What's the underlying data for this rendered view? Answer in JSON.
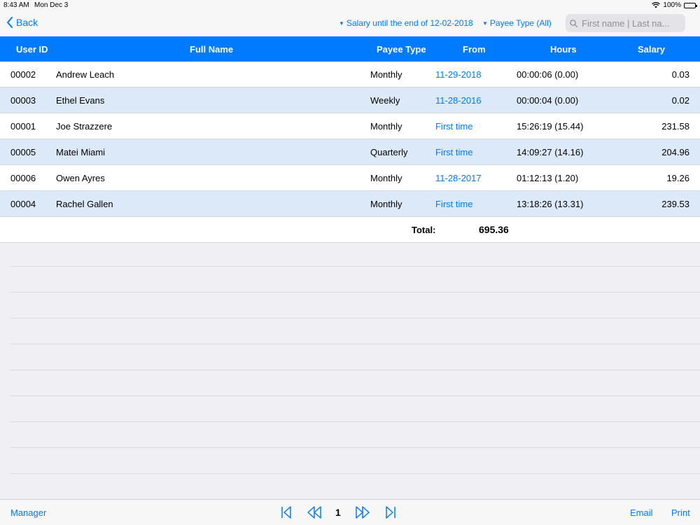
{
  "status_bar": {
    "time": "8:43 AM",
    "date": "Mon Dec 3",
    "battery": "100%"
  },
  "navbar": {
    "back_label": "Back",
    "salary_filter": "Salary until the end of 12-02-2018",
    "payee_filter": "Payee Type (All)",
    "search_placeholder": "First name | Last na..."
  },
  "table": {
    "columns": [
      "User ID",
      "Full Name",
      "Payee Type",
      "From",
      "Hours",
      "Salary"
    ],
    "rows": [
      {
        "user_id": "00002",
        "full_name": "Andrew Leach",
        "payee_type": "Monthly",
        "from": "11-29-2018",
        "hours": "00:00:06 (0.00)",
        "salary": "0.03"
      },
      {
        "user_id": "00003",
        "full_name": "Ethel Evans",
        "payee_type": "Weekly",
        "from": "11-28-2016",
        "hours": "00:00:04 (0.00)",
        "salary": "0.02"
      },
      {
        "user_id": "00001",
        "full_name": "Joe Strazzere",
        "payee_type": "Monthly",
        "from": "First time",
        "hours": "15:26:19 (15.44)",
        "salary": "231.58"
      },
      {
        "user_id": "00005",
        "full_name": "Matei Miami",
        "payee_type": "Quarterly",
        "from": "First time",
        "hours": "14:09:27 (14.16)",
        "salary": "204.96"
      },
      {
        "user_id": "00006",
        "full_name": "Owen Ayres",
        "payee_type": "Monthly",
        "from": "11-28-2017",
        "hours": "01:12:13 (1.20)",
        "salary": "19.26"
      },
      {
        "user_id": "00004",
        "full_name": "Rachel Gallen",
        "payee_type": "Monthly",
        "from": "First time",
        "hours": "13:18:26 (13.31)",
        "salary": "239.53"
      }
    ],
    "total_label": "Total:",
    "total_value": "695.36"
  },
  "toolbar": {
    "manager_label": "Manager",
    "page_number": "1",
    "email_label": "Email",
    "print_label": "Print"
  },
  "colors": {
    "accent": "#007aff",
    "row_alt": "#dce9f8",
    "background": "#efeff4"
  }
}
